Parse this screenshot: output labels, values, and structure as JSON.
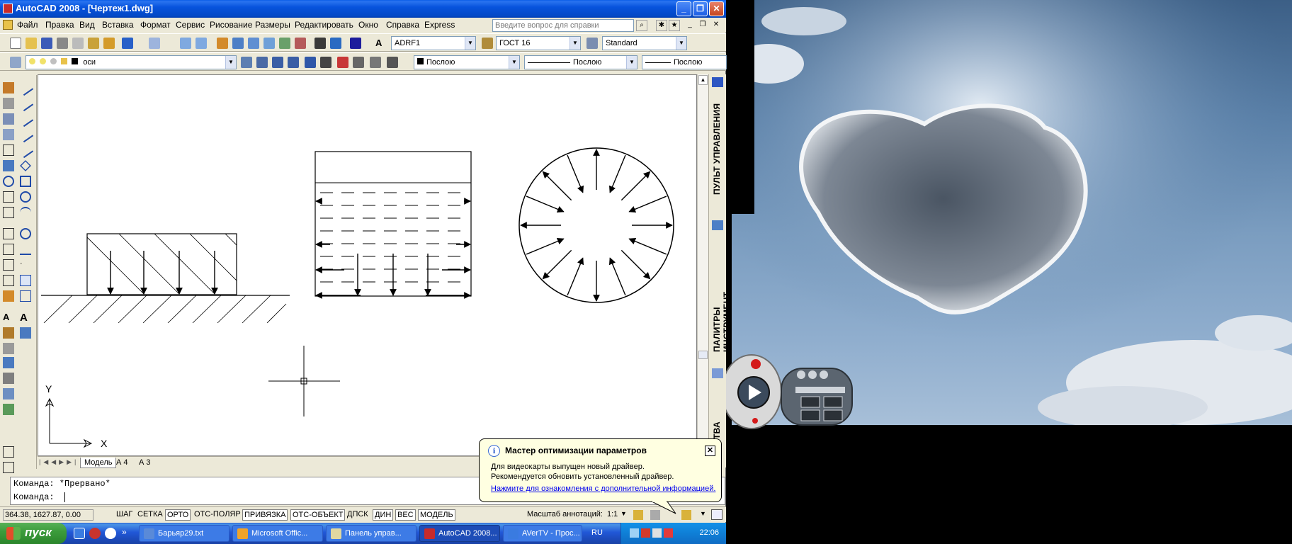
{
  "window": {
    "title": "AutoCAD 2008 - [Чертеж1.dwg]",
    "controls": [
      "_",
      "❐",
      "✕"
    ]
  },
  "menu": {
    "items": [
      "Файл",
      "Правка",
      "Вид",
      "Вставка",
      "Формат",
      "Сервис",
      "Рисование",
      "Размеры",
      "Редактировать",
      "Окно",
      "Справка",
      "Express"
    ],
    "help_placeholder": "Введите вопрос для справки"
  },
  "toolbar": {
    "text_style": "ADRF1",
    "dim_style": "ГОСТ 16",
    "table_style": "Standard",
    "layer": "оси",
    "color": "Послою",
    "linetype": "Послою",
    "lineweight": "Послою"
  },
  "canvas": {
    "ucs_x": "X",
    "ucs_y": "Y"
  },
  "side_panel": {
    "panel1": "ПУЛЬТ УПРАВЛЕНИЯ",
    "panel2": "ПАЛИТРЫ ИНСТРУМЕНТ...",
    "panel3": "ТВА"
  },
  "layout_tabs": [
    "Модель",
    "А 4",
    "А 3"
  ],
  "command_line": {
    "line1": "Команда: *Прервано*",
    "line2": "Команда:"
  },
  "status_bar": {
    "coords": "364.38,  1627.87, 0.00",
    "toggles": [
      "ШАГ",
      "СЕТКА",
      "ОРТО",
      "ОТС-ПОЛЯР",
      "ПРИВЯЗКА",
      "ОТС-ОБЪЕКТ",
      "ДПСК",
      "ДИН",
      "ВЕС",
      "МОДЕЛЬ"
    ],
    "toggles_on": [
      "ОРТО",
      "ПРИВЯЗКА",
      "ОТС-ОБЪЕКТ",
      "ДИН",
      "ВЕС",
      "МОДЕЛЬ"
    ],
    "annotation_label": "Масштаб аннотаций:",
    "annotation_scale": "1:1"
  },
  "balloon": {
    "title": "Мастер оптимизации параметров",
    "line1": "Для видеокарты выпущен новый драйвер.",
    "line2": "Рекомендуется обновить установленный драйвер.",
    "link": "Нажмите для ознакомления с дополнительной информацией."
  },
  "taskbar": {
    "start": "пуск",
    "buttons": [
      "Барьяр29.txt",
      "Microsoft Offic...",
      "Панель управ...",
      "AutoCAD 2008...",
      "AVerTV - Прос..."
    ],
    "active": "AutoCAD 2008...",
    "lang": "RU",
    "clock": "22:06"
  },
  "colors": {
    "title_blue": "#0753dd",
    "taskbar_blue": "#2157d7",
    "start_green": "#3c9c3c",
    "balloon_bg": "#ffffe1",
    "sky": "#5a80a8"
  }
}
